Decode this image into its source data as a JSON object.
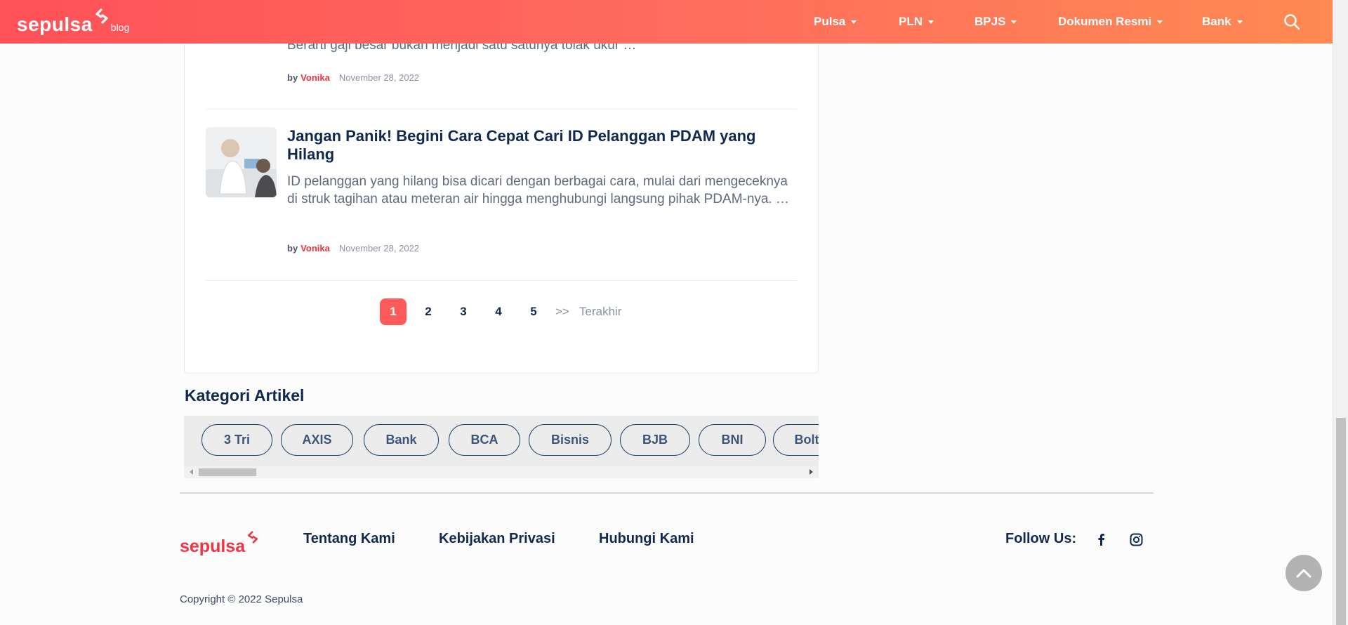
{
  "navbar": {
    "brand": "sepulsa",
    "brand_sub": "blog",
    "items": [
      {
        "label": "Pulsa"
      },
      {
        "label": "PLN"
      },
      {
        "label": "BPJS"
      },
      {
        "label": "Dokumen Resmi"
      },
      {
        "label": "Bank"
      }
    ],
    "search_icon": "search-icon",
    "colors": {
      "gradient_start": "#ff5158",
      "gradient_end": "#ff8a52"
    }
  },
  "articles": [
    {
      "title": "",
      "excerpt": "Berarti gaji besar bukan menjadi satu satunya tolak ukur …",
      "by": "by",
      "author": "Vonika",
      "date": "November 28, 2022"
    },
    {
      "title": "Jangan Panik! Begini Cara Cepat Cari ID Pelanggan PDAM yang Hilang",
      "excerpt": "ID pelanggan yang hilang bisa dicari dengan berbagai cara, mulai dari mengeceknya di struk tagihan atau meteran air hingga menghubungi langsung pihak PDAM-nya. …",
      "by": "by",
      "author": "Vonika",
      "date": "November 28, 2022"
    }
  ],
  "pagination": {
    "pages": [
      "1",
      "2",
      "3",
      "4",
      "5"
    ],
    "current": "1",
    "next_symbol": ">>",
    "last_label": "Terakhir"
  },
  "categories": {
    "title": "Kategori Artikel",
    "items": [
      "3 Tri",
      "AXIS",
      "Bank",
      "BCA",
      "Bisnis",
      "BJB",
      "BNI",
      "Bolt"
    ]
  },
  "footer": {
    "brand": "sepulsa",
    "links": [
      "Tentang Kami",
      "Kebijakan Privasi",
      "Hubungi Kami"
    ],
    "follow_label": "Follow Us:",
    "social_icons": [
      "facebook-icon",
      "instagram-icon"
    ],
    "copyright": "Copyright © 2022 Sepulsa"
  },
  "accent_color": "#ee3342"
}
